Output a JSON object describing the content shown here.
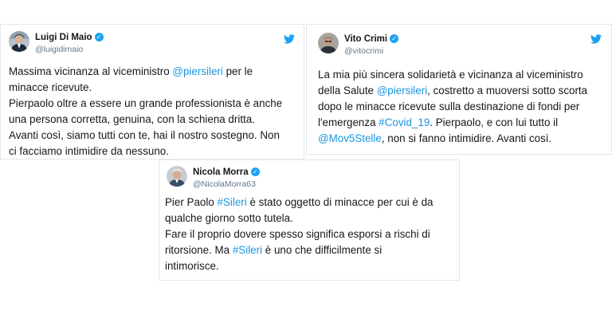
{
  "colors": {
    "link": "#1b95e0",
    "verified": "#1da1f2",
    "border": "#e1e8ed",
    "handle": "#657786"
  },
  "tweets": [
    {
      "name": "Luigi Di Maio",
      "handle": "@luigidimaio",
      "lines": [
        [
          {
            "text": "Massima vicinanza al viceministro "
          },
          {
            "text": "@piersileri",
            "link": true
          },
          {
            "text": " per le"
          }
        ],
        [
          {
            "text": "minacce ricevute."
          }
        ],
        [
          {
            "text": "Pierpaolo oltre a essere un grande professionista è anche"
          }
        ],
        [
          {
            "text": "una persona corretta, genuina, con la schiena dritta."
          }
        ],
        [
          {
            "text": "Avanti così, siamo tutti con te, hai il nostro sostegno. Non"
          }
        ],
        [
          {
            "text": "ci facciamo intimidire da nessuno."
          }
        ]
      ]
    },
    {
      "name": "Vito Crimi",
      "handle": "@vitocrimi",
      "lines": [
        [
          {
            "text": "La mia più sincera solidarietà e vicinanza al viceministro"
          }
        ],
        [
          {
            "text": "della Salute "
          },
          {
            "text": "@piersileri",
            "link": true
          },
          {
            "text": ", costretto a muoversi sotto scorta"
          }
        ],
        [
          {
            "text": "dopo le minacce ricevute sulla destinazione di fondi per"
          }
        ],
        [
          {
            "text": "l'emergenza "
          },
          {
            "text": "#Covid_19",
            "link": true
          },
          {
            "text": ". Pierpaolo, e con lui tutto il"
          }
        ],
        [
          {
            "text": "@Mov5Stelle",
            "link": true
          },
          {
            "text": ", non si fanno intimidire. Avanti così."
          }
        ]
      ]
    },
    {
      "name": "Nicola Morra",
      "handle": "@NicolaMorra63",
      "lines": [
        [
          {
            "text": "Pier Paolo "
          },
          {
            "text": "#Sileri",
            "link": true
          },
          {
            "text": " è stato oggetto di minacce per cui è da"
          }
        ],
        [
          {
            "text": "qualche giorno sotto tutela."
          }
        ],
        [
          {
            "text": "Fare il proprio dovere spesso significa esporsi a rischi di"
          }
        ],
        [
          {
            "text": "ritorsione. Ma "
          },
          {
            "text": "#Sileri",
            "link": true
          },
          {
            "text": " è uno che difficilmente si"
          }
        ],
        [
          {
            "text": "intimorisce."
          }
        ]
      ]
    }
  ]
}
